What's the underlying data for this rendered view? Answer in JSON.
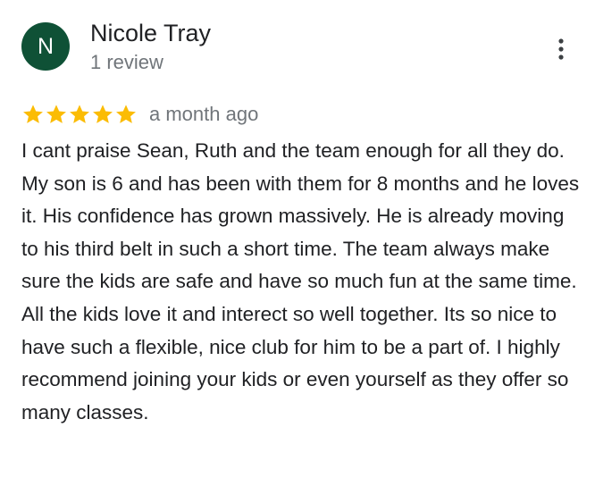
{
  "reviewer": {
    "initial": "N",
    "name": "Nicole Tray",
    "review_count": "1 review",
    "avatar_color": "#0f5136"
  },
  "review": {
    "rating": 5,
    "max_rating": 5,
    "star_color": "#fbbc04",
    "time": "a month ago",
    "text": "I cant praise Sean, Ruth and the team enough for all they do. My son is 6 and has been with them for 8 months and he loves it. His confidence has grown massively. He is already moving to his third belt in such a short time. The team always make sure the kids are safe and have so much fun at the same time. All the kids love it and interect so well together. Its so nice to have such a flexible, nice club for him to be a part of. I highly recommend joining your kids or even yourself as they offer so many classes."
  },
  "icons": {
    "menu": "more-vertical-icon",
    "star": "star-icon"
  }
}
